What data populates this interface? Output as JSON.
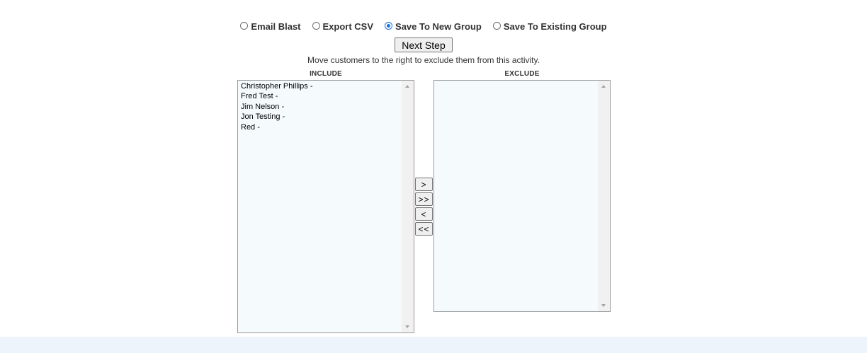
{
  "actions": {
    "options": [
      {
        "label": "Email Blast",
        "checked": false
      },
      {
        "label": "Export CSV",
        "checked": false
      },
      {
        "label": "Save To New Group",
        "checked": true
      },
      {
        "label": "Save To Existing Group",
        "checked": false
      }
    ],
    "next_label": "Next Step"
  },
  "instructions": "Move customers to the right to exclude them from this activity.",
  "include": {
    "heading": "INCLUDE",
    "items": [
      "Christopher Phillips -",
      "Fred Test -",
      "Jim Nelson -",
      "Jon Testing -",
      "Red -"
    ]
  },
  "exclude": {
    "heading": "EXCLUDE",
    "items": []
  },
  "move_buttons": {
    "move_one_right": ">",
    "move_all_right": ">>",
    "move_one_left": "<",
    "move_all_left": "<<"
  },
  "colors": {
    "radio_checked": "#1a73e8",
    "listbox_bg": "#f5fafd",
    "footer_band": "#eef4fc"
  }
}
